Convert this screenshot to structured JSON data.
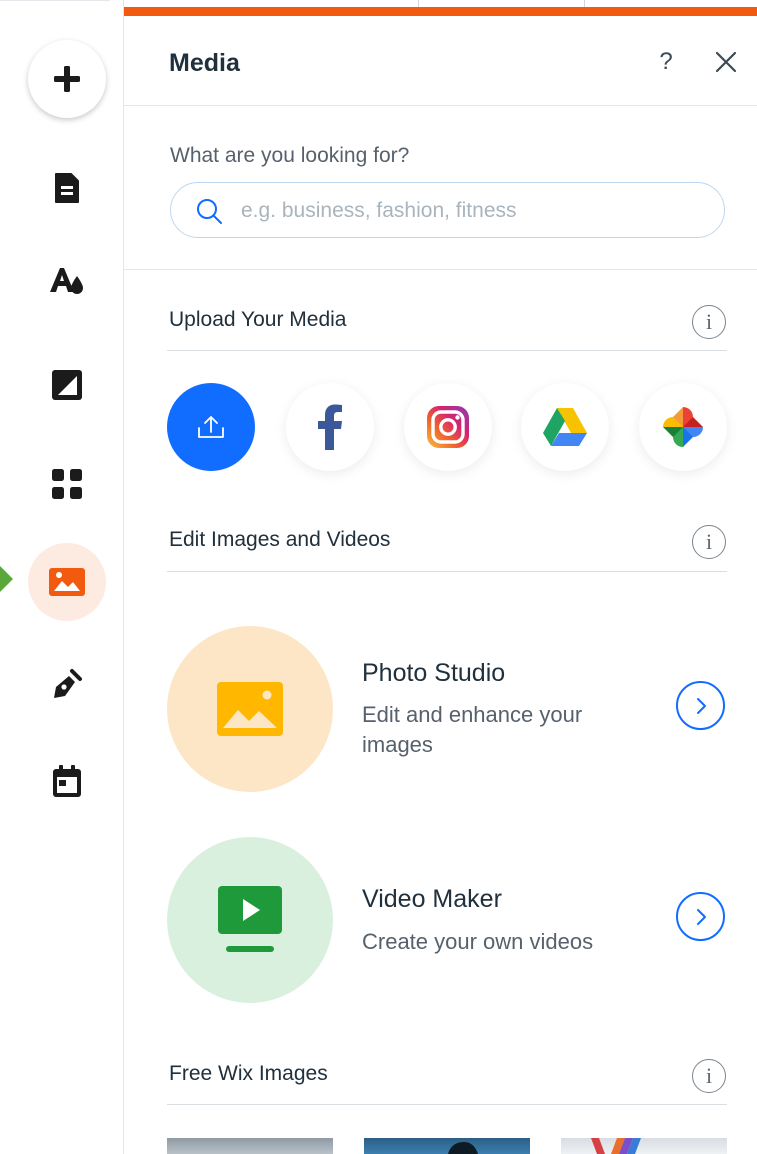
{
  "panel": {
    "title": "Media",
    "help_label": "?"
  },
  "search": {
    "label": "What are you looking for?",
    "placeholder": "e.g. business, fashion, fitness",
    "value": ""
  },
  "sections": {
    "upload": {
      "title": "Upload Your Media",
      "info": "i"
    },
    "edit": {
      "title": "Edit Images and Videos",
      "info": "i"
    },
    "free": {
      "title": "Free Wix Images",
      "info": "i"
    }
  },
  "sources": [
    "upload-icon",
    "facebook-icon",
    "instagram-icon",
    "google-drive-icon",
    "google-photos-icon"
  ],
  "tools": [
    {
      "title": "Photo Studio",
      "description": "Edit and enhance your images",
      "icon": "image-icon"
    },
    {
      "title": "Video Maker",
      "description": "Create your own videos",
      "icon": "video-icon"
    }
  ],
  "rail": {
    "items": [
      "add-icon",
      "pages-icon",
      "theme-icon",
      "background-icon",
      "apps-icon",
      "media-icon",
      "blog-icon",
      "bookings-icon"
    ],
    "active": "media-icon"
  },
  "colors": {
    "accent_orange": "#f25a10",
    "primary_blue": "#116dff",
    "photo_bg": "#fde6c5",
    "photo_icon": "#ffb700",
    "video_bg": "#daf0de",
    "video_icon": "#1e9a3a",
    "active_rail_bg": "#fdebe2",
    "rail_arrow": "#5aa83a"
  }
}
